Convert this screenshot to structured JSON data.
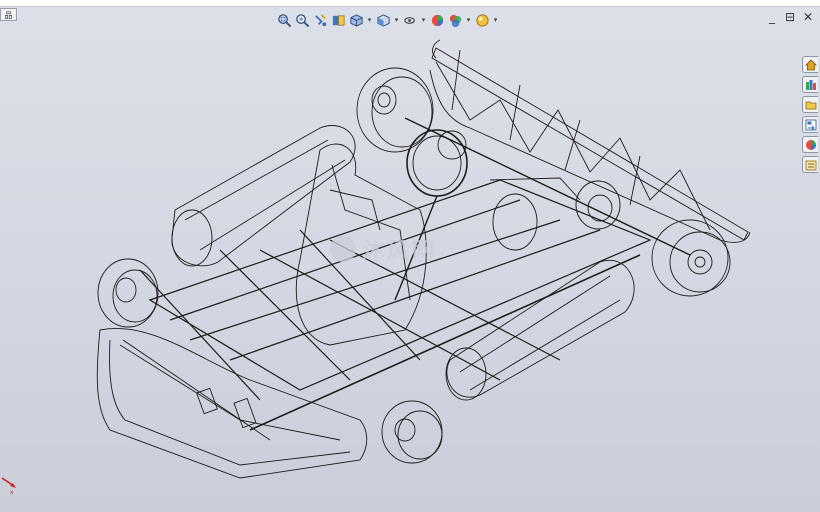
{
  "window": {
    "tab_stub_label": "品",
    "controls": [
      "_",
      "⊟",
      "✕"
    ]
  },
  "toolbar": {
    "icons": [
      "zoom-fit-icon",
      "zoom-area-icon",
      "previous-view-icon",
      "section-view-icon",
      "view-orientation-icon",
      "display-style-icon",
      "hide-show-items-icon",
      "edit-appearance-icon",
      "apply-scene-icon",
      "view-settings-icon"
    ],
    "dropdown_arrow": "▾"
  },
  "task_pane": {
    "icons": [
      "home-icon",
      "design-library-icon",
      "file-explorer-icon",
      "view-palette-icon",
      "appearances-icon",
      "custom-properties-icon"
    ]
  },
  "watermark": {
    "text": "沐风网"
  },
  "colors": {
    "viewport_top": "#dde0e8",
    "viewport_bottom": "#c9ced9",
    "wireframe": "#1c1c1c",
    "axis_red": "#cc1f1f"
  }
}
